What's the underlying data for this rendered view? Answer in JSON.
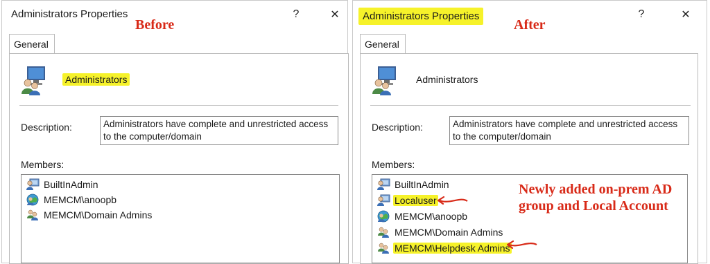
{
  "dialogs": {
    "before": {
      "title": "Administrators Properties",
      "tag": "Before",
      "tab": "General",
      "group_name": "Administrators",
      "description_label": "Description:",
      "description": "Administrators have complete and unrestricted access to the computer/domain",
      "members_label": "Members:",
      "members": [
        "BuiltInAdmin",
        "MEMCM\\anoopb",
        "MEMCM\\Domain Admins"
      ]
    },
    "after": {
      "title": "Administrators Properties",
      "tag": "After",
      "tab": "General",
      "group_name": "Administrators",
      "description_label": "Description:",
      "description": "Administrators have complete and unrestricted access to the computer/domain",
      "members_label": "Members:",
      "members": [
        "BuiltInAdmin",
        "Localuser",
        "MEMCM\\anoopb",
        "MEMCM\\Domain Admins",
        "MEMCM\\Helpdesk Admins"
      ]
    }
  },
  "annotation": "Newly added on-prem AD group and Local Account",
  "icons": {
    "help": "?",
    "close": "✕",
    "group": "group-icon",
    "user": "user-icon",
    "domain_user": "domain-user-icon",
    "domain_group": "domain-group-icon"
  },
  "colors": {
    "highlight": "#f6f22a",
    "annotation_red": "#d82a18"
  }
}
